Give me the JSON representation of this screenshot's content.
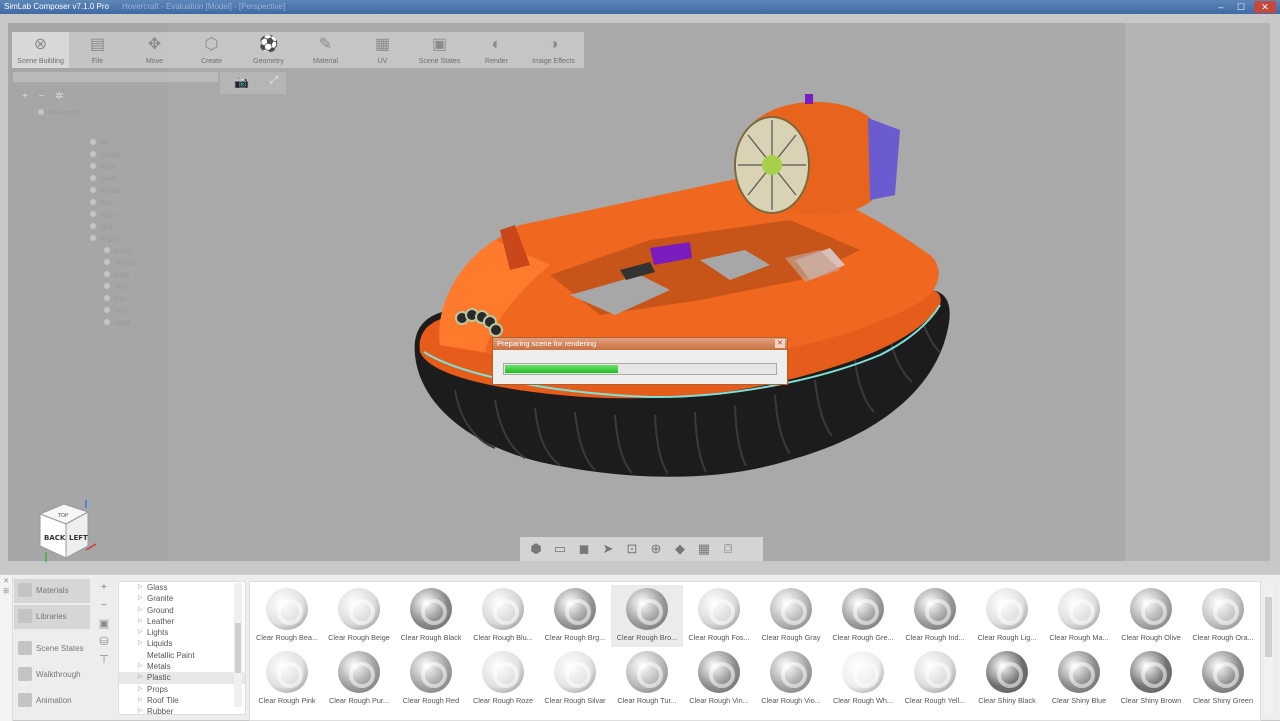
{
  "window": {
    "title": "SimLab Composer v7.1.0 Pro",
    "faded_title": "Hovercraft - Evaluation [Model] - [Perspective]",
    "min_glyph": "–",
    "max_glyph": "☐",
    "close_glyph": "✕"
  },
  "ribbon": [
    {
      "label": "Scene Building",
      "icon": "scene-building-icon",
      "glyph": "⊗"
    },
    {
      "label": "File",
      "icon": "file-icon",
      "glyph": "▤"
    },
    {
      "label": "Move",
      "icon": "move-icon",
      "glyph": "✥"
    },
    {
      "label": "Create",
      "icon": "create-icon",
      "glyph": "⬡"
    },
    {
      "label": "Geometry",
      "icon": "geometry-icon",
      "glyph": "⚽"
    },
    {
      "label": "Material",
      "icon": "material-icon",
      "glyph": "✎"
    },
    {
      "label": "UV",
      "icon": "uv-icon",
      "glyph": "▦"
    },
    {
      "label": "Scene States",
      "icon": "scene-states-icon",
      "glyph": "▣"
    },
    {
      "label": "Render",
      "icon": "render-icon",
      "glyph": "◐"
    },
    {
      "label": "Image Effects",
      "icon": "image-effects-icon",
      "glyph": "◑"
    }
  ],
  "tree": {
    "root": "Hovercraft",
    "items": [
      "fan",
      "rudder",
      "body",
      "seats",
      "handle",
      "floor",
      "lights",
      "skirt",
      "engine",
      "tubes",
      "wheels",
      "parts",
      "deck",
      "trim",
      "vent",
      "seat2"
    ]
  },
  "progress": {
    "title": "Preparing scene for rendering",
    "value": 0.42,
    "close_glyph": "✕"
  },
  "navcube": {
    "top": "TOP",
    "front": "BACK",
    "side": "LEFT"
  },
  "bottom_tabs": [
    {
      "label": "Materials",
      "icon": "materials-icon"
    },
    {
      "label": "Libraries",
      "icon": "libraries-icon"
    },
    {
      "label": "Scene States",
      "icon": "scene-states-icon"
    },
    {
      "label": "Walkthrough",
      "icon": "walkthrough-icon"
    },
    {
      "label": "Animation",
      "icon": "animation-icon"
    }
  ],
  "categories": [
    "Glass",
    "Granite",
    "Ground",
    "Leather",
    "Lights",
    "Liquids",
    "Metallic Paint",
    "Metals",
    "Plastic",
    "Props",
    "Roof Tile",
    "Rubber"
  ],
  "selected_category": "Plastic",
  "materials_row1": [
    {
      "name": "Clear Rough Bea...",
      "color": "#e2e2e2"
    },
    {
      "name": "Clear Rough Beige",
      "color": "#dcdcdc"
    },
    {
      "name": "Clear Rough Black",
      "color": "#8a8a8a"
    },
    {
      "name": "Clear Rough Blu...",
      "color": "#d8d8d8"
    },
    {
      "name": "Clear Rough Brg...",
      "color": "#969696"
    },
    {
      "name": "Clear Rough Bro...",
      "color": "#9a9a9a"
    },
    {
      "name": "Clear Rough Fos...",
      "color": "#dadada"
    },
    {
      "name": "Clear Rough Gray",
      "color": "#b5b5b5"
    },
    {
      "name": "Clear Rough Gre...",
      "color": "#9c9c9c"
    },
    {
      "name": "Clear Rough Ind...",
      "color": "#989898"
    },
    {
      "name": "Clear Rough Lig...",
      "color": "#e0e0e0"
    },
    {
      "name": "Clear Rough Ma...",
      "color": "#dedede"
    },
    {
      "name": "Clear Rough Olive",
      "color": "#a8a8a8"
    },
    {
      "name": "Clear Rough Ora...",
      "color": "#c2c2c2"
    }
  ],
  "materials_row2": [
    {
      "name": "Clear Rough Pink",
      "color": "#e0e0e0"
    },
    {
      "name": "Clear Rough Pur...",
      "color": "#a0a0a0"
    },
    {
      "name": "Clear Rough Red",
      "color": "#a4a4a4"
    },
    {
      "name": "Clear Rough Roze",
      "color": "#e0e0e0"
    },
    {
      "name": "Clear Rough Silvar",
      "color": "#e4e4e4"
    },
    {
      "name": "Clear Rough Tur...",
      "color": "#b6b6b6"
    },
    {
      "name": "Clear Rough Vin...",
      "color": "#8e8e8e"
    },
    {
      "name": "Clear Rough Vio...",
      "color": "#a6a6a6"
    },
    {
      "name": "Clear Rough Wh...",
      "color": "#eeeeee"
    },
    {
      "name": "Clear Rough Yell...",
      "color": "#dcdcdc"
    },
    {
      "name": "Clear Shiny Black",
      "color": "#6e6e6e"
    },
    {
      "name": "Clear Shiny Blue",
      "color": "#8c8c8c"
    },
    {
      "name": "Clear Shiny Brown",
      "color": "#727272"
    },
    {
      "name": "Clear Shiny Green",
      "color": "#8c8c8c"
    }
  ],
  "selected_material": "Clear Rough Bro..."
}
